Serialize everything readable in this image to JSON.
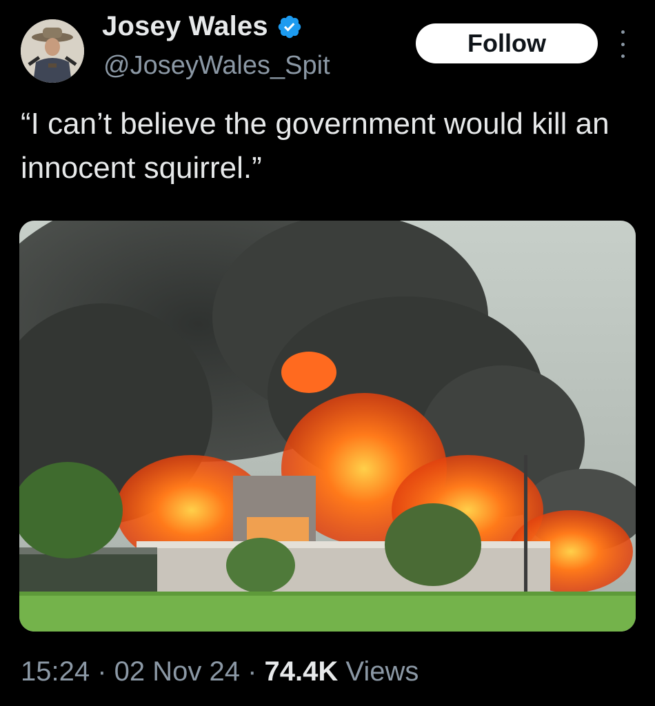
{
  "author": {
    "display_name": "Josey Wales",
    "handle": "@JoseyWales_Spit",
    "verified": true,
    "verified_color": "#1d9bf0"
  },
  "actions": {
    "follow_label": "Follow",
    "more_icon": "more-vertical-icon"
  },
  "tweet": {
    "text": "“I can’t believe the government would kill an innocent squirrel.”"
  },
  "media": {
    "icon": "photo"
  },
  "meta": {
    "time": "15:24",
    "separator": " · ",
    "date": "02 Nov 24",
    "views_count": "74.4K",
    "views_label": " Views"
  },
  "colors": {
    "background": "#000000",
    "primary_text": "#e7e9ea",
    "secondary_text": "#8b98a5",
    "follow_button_bg": "#ffffff"
  }
}
